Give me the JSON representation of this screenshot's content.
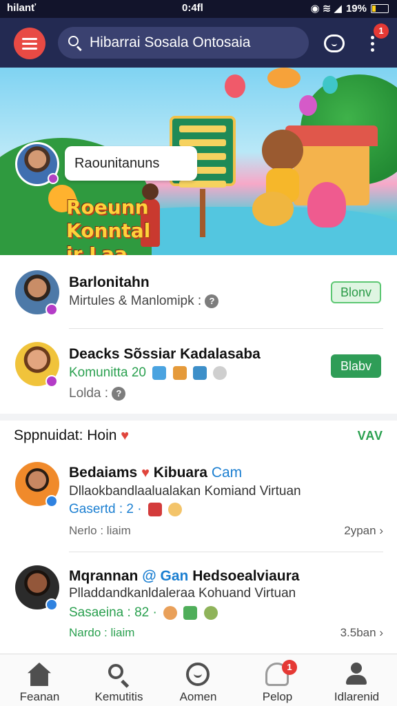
{
  "status_bar": {
    "carrier": "hilanť",
    "time": "0:4fl",
    "battery": "19%",
    "battery_level": 0.19
  },
  "app_bar": {
    "search_text": "Hibarrai Sosala Ontosaia",
    "notification_count": "1"
  },
  "banner": {
    "pill_text": "Raounitanuns",
    "title_lines": [
      "Roeunn",
      "Konntal",
      "ir Laa."
    ]
  },
  "contacts": [
    {
      "name": "Barlonitahn",
      "subtitle": "Mirtules & Manlomipk :",
      "action": "Blonv"
    },
    {
      "name": "Deacks Sõssiar Kadalasaba",
      "subtitle": "Komunitta 20",
      "extra": "Lolda :",
      "action": "Blabv"
    }
  ],
  "section": {
    "title": "Sppnuidat: Hoin",
    "see_all": "VAV"
  },
  "posts": [
    {
      "name": "Bedaiams",
      "name_suffix": "Kibuara",
      "tag": "Cam",
      "desc": "Dllaokbandlaalualakan Komiand Virtuan",
      "stat": "Gasertd : 2 ·",
      "meta": "Nerlo : liaim",
      "time": "2ypan"
    },
    {
      "name": "Mqrannan",
      "tag": "Gan",
      "name_suffix": "Hedsoealviaura",
      "desc": "Plladdandkanldaleraa Kohuand Virtuan",
      "stat": "Sasaeina : 82 ·",
      "meta": "Nardo : liaim",
      "time": "3.5ban"
    }
  ],
  "bottom_nav": [
    {
      "label": "Feanan",
      "icon": "home-icon"
    },
    {
      "label": "Kemutitis",
      "icon": "search-icon"
    },
    {
      "label": "Aomen",
      "icon": "chat-icon"
    },
    {
      "label": "Pelop",
      "icon": "bell-icon",
      "badge": "1"
    },
    {
      "label": "Idlarenid",
      "icon": "user-icon"
    }
  ],
  "colors": {
    "app_bar": "#232a52",
    "accent_red": "#e84a44",
    "green": "#2f9d57"
  }
}
